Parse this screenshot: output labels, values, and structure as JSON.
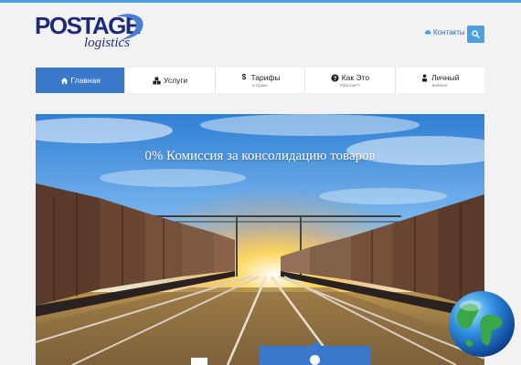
{
  "header": {
    "logo_main": "POSTAGE",
    "logo_sub": "logistics",
    "contacts_label": "Контакты"
  },
  "nav": {
    "items": [
      {
        "label": "Главная",
        "sub": "",
        "icon": "home-icon"
      },
      {
        "label": "Услуги",
        "sub": "",
        "icon": "cubes-icon"
      },
      {
        "label": "Тарифы",
        "sub": "и Сроки",
        "icon": "dollar-icon"
      },
      {
        "label": "Как Это",
        "sub": "Работает?",
        "icon": "question-icon"
      },
      {
        "label": "Личный",
        "sub": "Кабинет",
        "icon": "user-icon"
      }
    ],
    "active_index": 0
  },
  "hero": {
    "title": "0% Комиссия за консолидацию товаров"
  },
  "colors": {
    "accent": "#3a78c9",
    "top_strip": "#4aa0e0",
    "logo": "#1d2a7a",
    "link": "#2a6db3"
  }
}
